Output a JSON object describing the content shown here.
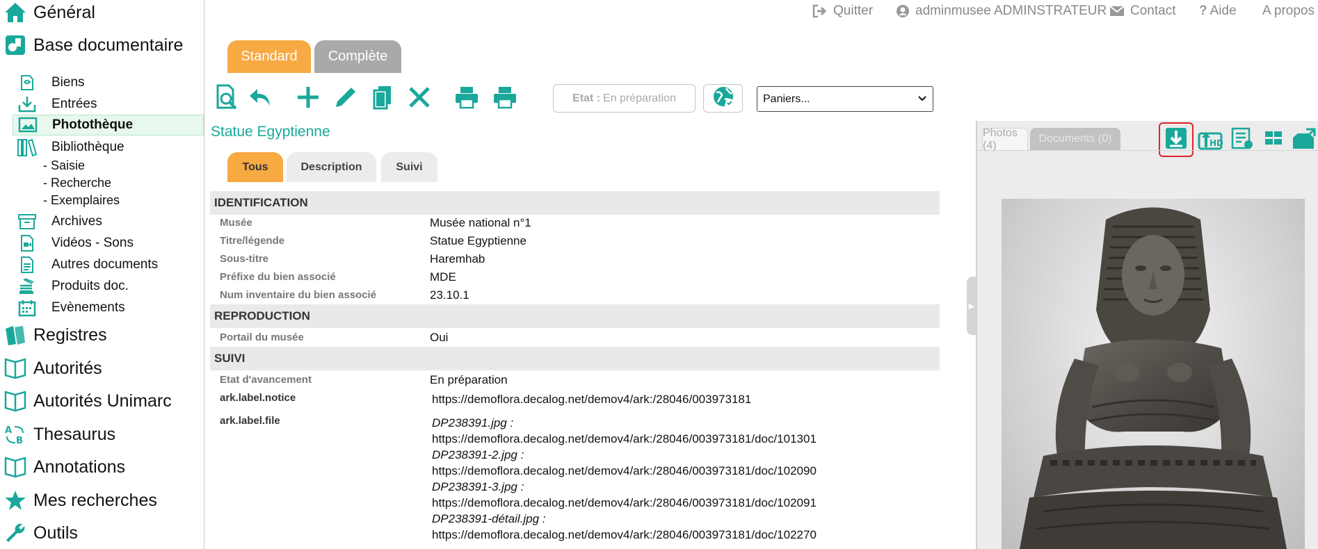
{
  "sidebar": {
    "top_items": [
      {
        "label": "Général",
        "icon": "home-icon"
      },
      {
        "label": "Base documentaire",
        "icon": "database-icon"
      },
      {
        "label": "Registres",
        "icon": "books-icon"
      },
      {
        "label": "Autorités",
        "icon": "open-book-icon"
      },
      {
        "label": "Autorités Unimarc",
        "icon": "open-book-icon"
      },
      {
        "label": "Thesaurus",
        "icon": "thesaurus-icon"
      },
      {
        "label": "Annotations",
        "icon": "open-book-icon"
      },
      {
        "label": "Mes recherches",
        "icon": "star-icon"
      },
      {
        "label": "Outils",
        "icon": "wrench-icon"
      }
    ],
    "sub_items": [
      {
        "label": "Biens",
        "icon": "object-icon"
      },
      {
        "label": "Entrées",
        "icon": "inbox-icon"
      },
      {
        "label": "Photothèque",
        "icon": "images-icon"
      },
      {
        "label": "Bibliothèque",
        "icon": "library-icon"
      },
      {
        "label": "Archives",
        "icon": "archive-box-icon"
      },
      {
        "label": "Vidéos - Sons",
        "icon": "video-file-icon"
      },
      {
        "label": "Autres documents",
        "icon": "document-icon"
      },
      {
        "label": "Produits doc.",
        "icon": "stack-icon"
      },
      {
        "label": "Evènements",
        "icon": "calendar-icon"
      }
    ],
    "library_subs": [
      "- Saisie",
      "- Recherche",
      "- Exemplaires"
    ]
  },
  "header": {
    "quit": "Quitter",
    "user": "adminmusee ADMINSTRATEUR",
    "contact": "Contact",
    "help": "Aide",
    "about": "A propos"
  },
  "main_tabs": [
    "Standard",
    "Complète"
  ],
  "state": {
    "label": "Etat :",
    "value": "En préparation"
  },
  "baskets_select": "Paniers...",
  "record_title": "Statue Egyptienne",
  "sub_tabs": [
    "Tous",
    "Description",
    "Suivi"
  ],
  "sections": {
    "identification": "IDENTIFICATION",
    "reproduction": "REPRODUCTION",
    "suivi": "SUIVI"
  },
  "fields": {
    "musee": {
      "label": "Musée",
      "value": "Musée national n°1"
    },
    "titre": {
      "label": "Titre/légende",
      "value": "Statue Egyptienne"
    },
    "sous_titre": {
      "label": "Sous-titre",
      "value": "Haremhab"
    },
    "prefixe": {
      "label": "Préfixe du bien associé",
      "value": "MDE"
    },
    "num_inv": {
      "label": "Num inventaire du bien associé",
      "value": "23.10.1"
    },
    "portail": {
      "label": "Portail du musée",
      "value": "Oui"
    },
    "etat": {
      "label": "Etat d'avancement",
      "value": "En préparation"
    },
    "ark_notice": {
      "label": "ark.label.notice",
      "value": "https://demoflora.decalog.net/demov4/ark:/28046/003973181"
    },
    "ark_file": {
      "label": "ark.label.file"
    }
  },
  "ark_files": [
    {
      "name": "DP238391.jpg :",
      "url": "https://demoflora.decalog.net/demov4/ark:/28046/003973181/doc/101301"
    },
    {
      "name": "DP238391-2.jpg :",
      "url": "https://demoflora.decalog.net/demov4/ark:/28046/003973181/doc/102090"
    },
    {
      "name": "DP238391-3.jpg :",
      "url": "https://demoflora.decalog.net/demov4/ark:/28046/003973181/doc/102091"
    },
    {
      "name": "DP238391-détail.jpg :",
      "url": "https://demoflora.decalog.net/demov4/ark:/28046/003973181/doc/102270"
    }
  ],
  "right_panel": {
    "photos_tab": "Photos (4)",
    "documents_tab": "Documents (0)"
  },
  "colors": {
    "accent_green": "#1aa89a",
    "orange_tab": "#f7a942",
    "grey_tab": "#a9a9a9",
    "highlight_red": "#e0222a"
  }
}
